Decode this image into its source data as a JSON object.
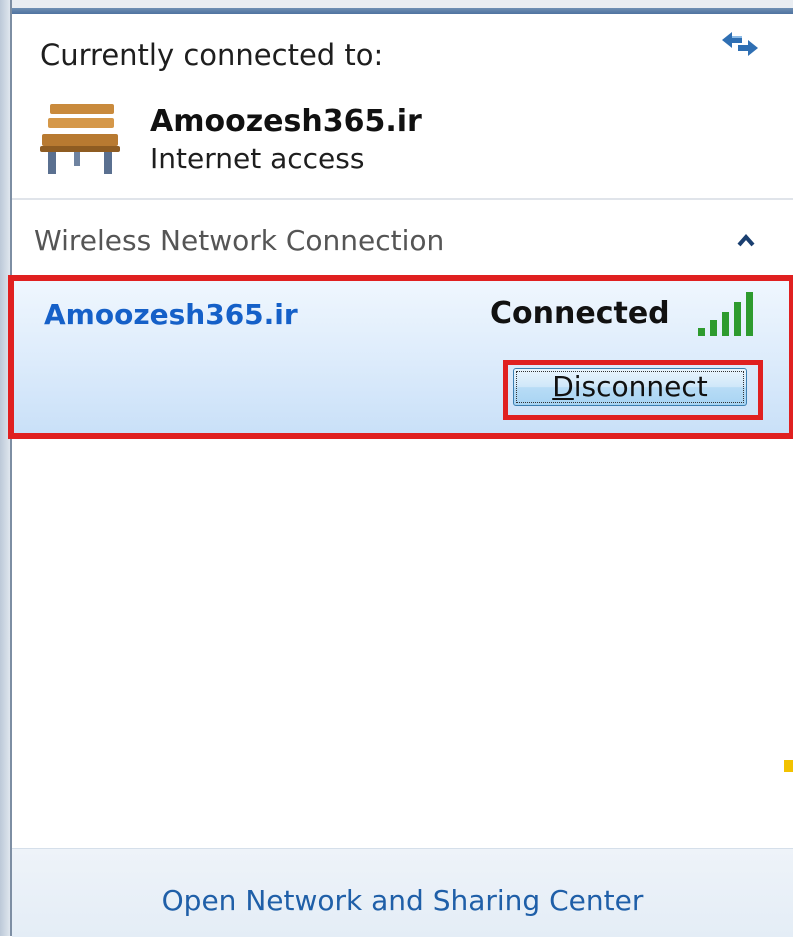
{
  "current": {
    "label": "Currently connected to:",
    "network_name": "Amoozesh365.ir",
    "access": "Internet access",
    "network_icon": "bench-icon",
    "refresh_icon": "refresh-arrows-icon"
  },
  "section": {
    "title": "Wireless Network Connection",
    "toggle_icon": "chevron-up-icon"
  },
  "wifi": {
    "name": "Amoozesh365.ir",
    "status": "Connected",
    "signal_icon": "signal-strength-icon",
    "signal_bars": 5,
    "button_label_accel": "D",
    "button_label_rest": "isconnect"
  },
  "footer": {
    "link": "Open Network and Sharing Center"
  },
  "colors": {
    "link": "#1f5fa8",
    "network_name": "#1560c8",
    "highlight": "#e02020",
    "signal": "#2e9b2e"
  }
}
